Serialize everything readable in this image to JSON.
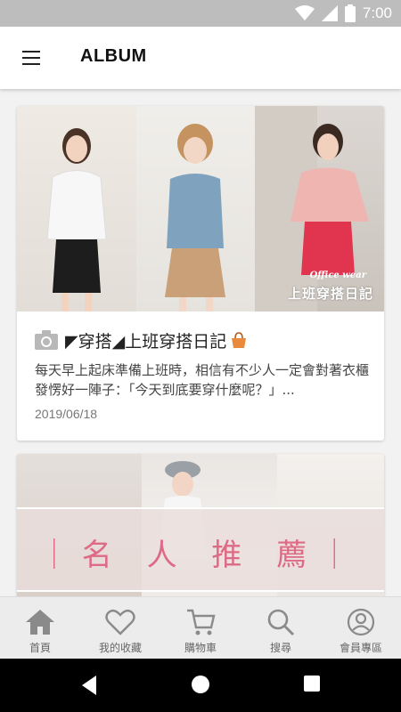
{
  "status_bar": {
    "time": "7:00",
    "icons": [
      "wifi-icon",
      "signal-icon",
      "battery-icon"
    ]
  },
  "app_bar": {
    "title": "ALBUM",
    "menu_icon": "hamburger-menu-icon"
  },
  "cards": [
    {
      "overlay_small": "Office wear",
      "overlay_text": "上班穿搭日記",
      "title": "◤穿搭◢上班穿搭日記",
      "excerpt": "每天早上起床準備上班時，相信有不少人一定會對著衣櫃發愣好一陣子：「今天到底要穿什麼呢？」...",
      "date": "2019/06/18",
      "icon": "camera-icon"
    },
    {
      "overlay_text": "｜名 人 推 薦｜"
    }
  ],
  "bottom_nav": [
    {
      "label": "首頁",
      "icon": "home-icon"
    },
    {
      "label": "我的收藏",
      "icon": "heart-icon"
    },
    {
      "label": "購物車",
      "icon": "cart-icon"
    },
    {
      "label": "搜尋",
      "icon": "search-icon"
    },
    {
      "label": "會員專區",
      "icon": "account-icon"
    }
  ],
  "colors": {
    "accent_pink": "#dd6b86",
    "nav_icon": "#8a8a8a",
    "status_bar": "#bdbdbd"
  }
}
